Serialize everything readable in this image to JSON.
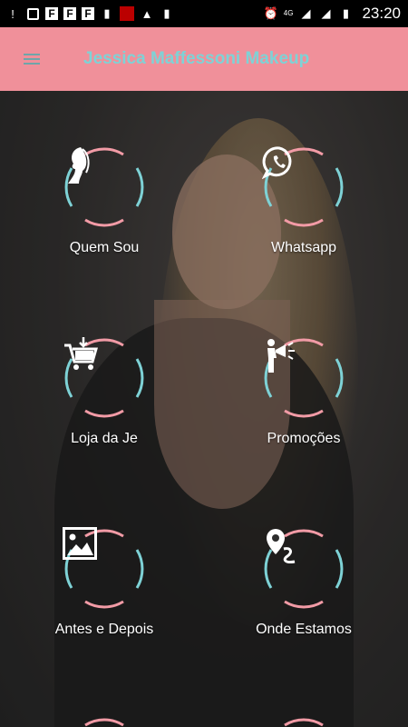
{
  "status_bar": {
    "left_icons": [
      "alert-icon",
      "instagram-icon",
      "flipboard-icon",
      "flipboard-icon",
      "flipboard-icon",
      "sd-card-icon",
      "news-icon",
      "warning-icon",
      "sd-card-icon"
    ],
    "network": "4G",
    "time": "23:20"
  },
  "app_bar": {
    "title": "Jessica Maffessoni Makeup",
    "background": "#f0909a",
    "title_color": "#7ed2d6"
  },
  "colors": {
    "ring_pink": "#f29ba6",
    "ring_teal": "#7ed2d6",
    "label": "#ffffff"
  },
  "tiles": [
    {
      "label": "Quem Sou",
      "icon": "woman-profile-icon"
    },
    {
      "label": "Whatsapp",
      "icon": "whatsapp-icon"
    },
    {
      "label": "Loja da Je",
      "icon": "shopping-cart-icon"
    },
    {
      "label": "Promoções",
      "icon": "megaphone-icon"
    },
    {
      "label": "Antes e Depois",
      "icon": "image-icon"
    },
    {
      "label": "Onde Estamos",
      "icon": "map-pin-icon"
    }
  ]
}
